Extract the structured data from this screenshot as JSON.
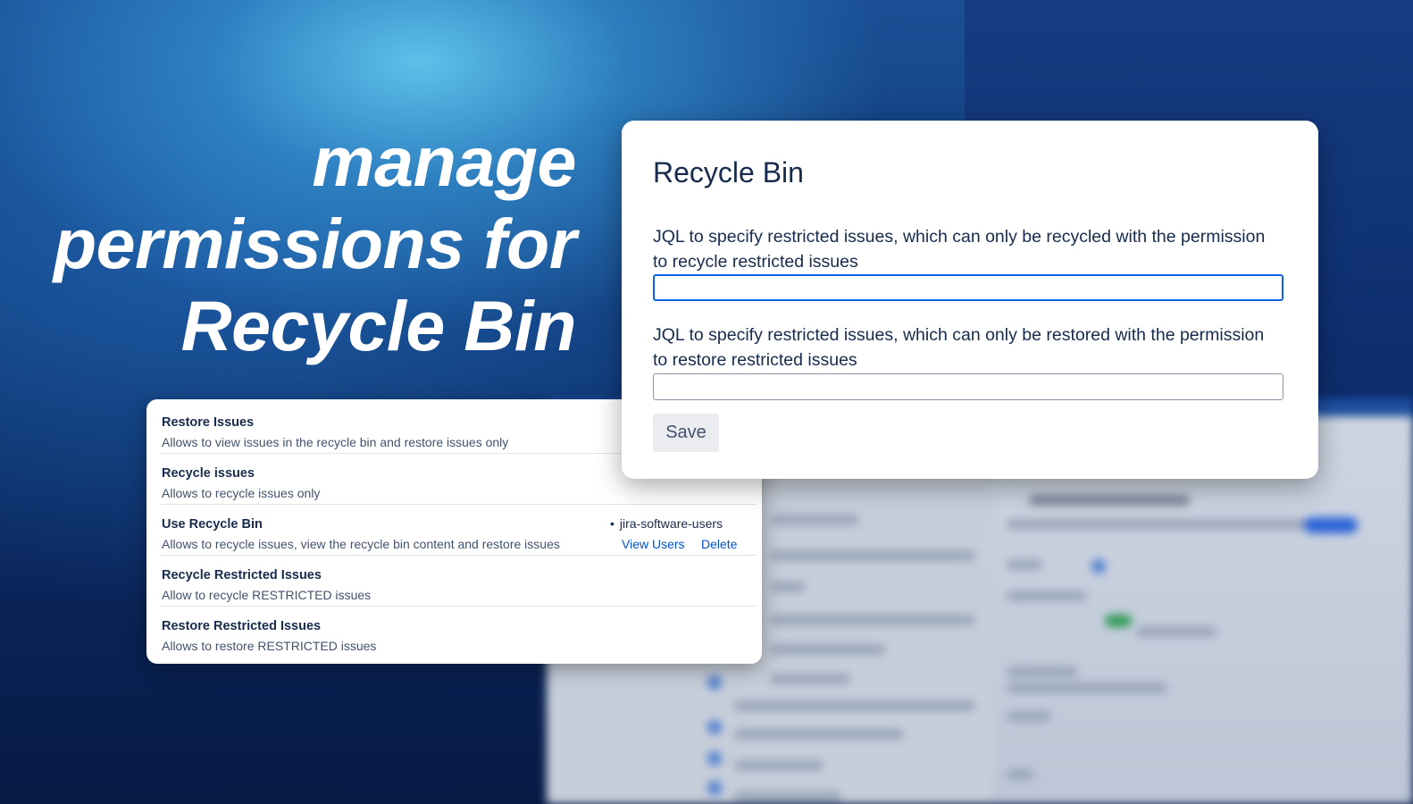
{
  "headline": {
    "line1": "manage",
    "line2": "permissions for",
    "line3": "Recycle Bin"
  },
  "permissions": [
    {
      "title": "Restore Issues",
      "description": "Allows to view issues in the recycle bin and restore issues only"
    },
    {
      "title": "Recycle issues",
      "description": "Allows to recycle issues only"
    },
    {
      "title": "Use Recycle Bin",
      "description": "Allows to recycle issues, view the recycle bin content and restore issues",
      "grant": "jira-software-users",
      "view_users_label": "View Users",
      "delete_label": "Delete"
    },
    {
      "title": "Recycle Restricted Issues",
      "description": "Allow to recycle RESTRICTED issues"
    },
    {
      "title": "Restore Restricted Issues",
      "description": "Allows to restore RESTRICTED issues"
    }
  ],
  "settings": {
    "title": "Recycle Bin",
    "recycle_label": "JQL to specify restricted issues, which can only be recycled with the permission to recycle restricted issues",
    "recycle_value": "",
    "restore_label": "JQL to specify restricted issues, which can only be restored with the permission to restore restricted issues",
    "restore_value": "",
    "save_label": "Save"
  },
  "colors": {
    "accent": "#0c66e4",
    "link": "#0052cc",
    "text": "#172b4d"
  }
}
